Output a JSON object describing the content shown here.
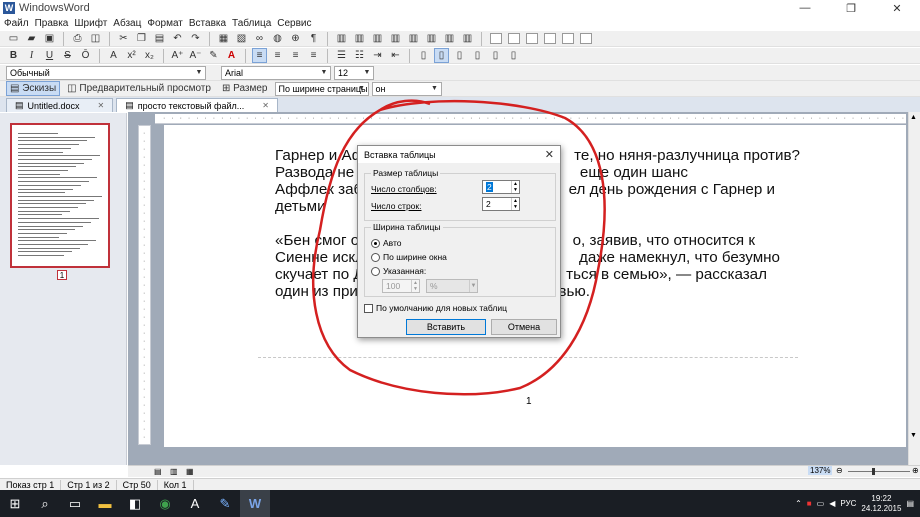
{
  "window": {
    "title": "WindowsWord",
    "app_icon": "W",
    "min": "—",
    "restore": "❐",
    "close": "✕"
  },
  "menu": [
    "Файл",
    "Правка",
    "Шрифт",
    "Абзац",
    "Формат",
    "Вставка",
    "Таблица",
    "Сервис"
  ],
  "format_bar": {
    "style": "Обычный",
    "font": "Arial",
    "size": "12"
  },
  "view_bar": {
    "thumbs": "Эскизы",
    "preview": "Предварительный просмотр",
    "size_label": "Размер",
    "zoom_mode": "По ширине страницы",
    "zoom_sub": "он"
  },
  "tabs": [
    {
      "label": "Untitled.docx"
    },
    {
      "label": "просто текстовый файл..."
    }
  ],
  "thumbnail": {
    "page": "1"
  },
  "document": {
    "para1": "Гарнер и Аффлек: ... те, но няня-разлучница против? Развода не ... ещё один шанс Аффлек заб... ел день рождения с Гарнер и детьми",
    "para1_lines": [
      "Гарнер и Афф",
      "Развода не",
      "Аффлек заб",
      "детьми"
    ],
    "para1_right": [
      "те, но няня-разлучница против?",
      "еще один шанс",
      "ел день рождения с Гарнер и",
      ""
    ],
    "para2_lines": [
      "«Бен смог о",
      "Сиенне искл",
      "скучает по Д",
      "один из приз"
    ],
    "para2_right": [
      "о, заявив, что относится к",
      "даже намекнул, что безумно",
      "ться в семью», — рассказал",
      "рвью."
    ],
    "page_number": "1"
  },
  "dialog": {
    "title": "Вставка таблицы",
    "group_size": "Размер таблицы",
    "cols_label": "Число столбцов:",
    "cols_value": "2",
    "rows_label": "Число строк:",
    "rows_value": "2",
    "group_width": "Ширина таблицы",
    "opt_auto": "Авто",
    "opt_window": "По ширине окна",
    "opt_fixed": "Указанная:",
    "width_value": "100",
    "width_unit": "%",
    "default_check": "По умолчанию для новых таблиц",
    "ok": "Вставить",
    "cancel": "Отмена"
  },
  "zoom": "137%",
  "status": {
    "view": "Показ стр 1",
    "page": "Стр 1 из 2",
    "row": "Стр 50",
    "col": "Кол 1"
  },
  "taskbar": {
    "lang": "РУС",
    "time": "19:22",
    "date": "24.12.2015"
  },
  "colors": {
    "annotation": "#d42020",
    "accent": "#2b579a",
    "taskbar": "#1a1e24"
  }
}
